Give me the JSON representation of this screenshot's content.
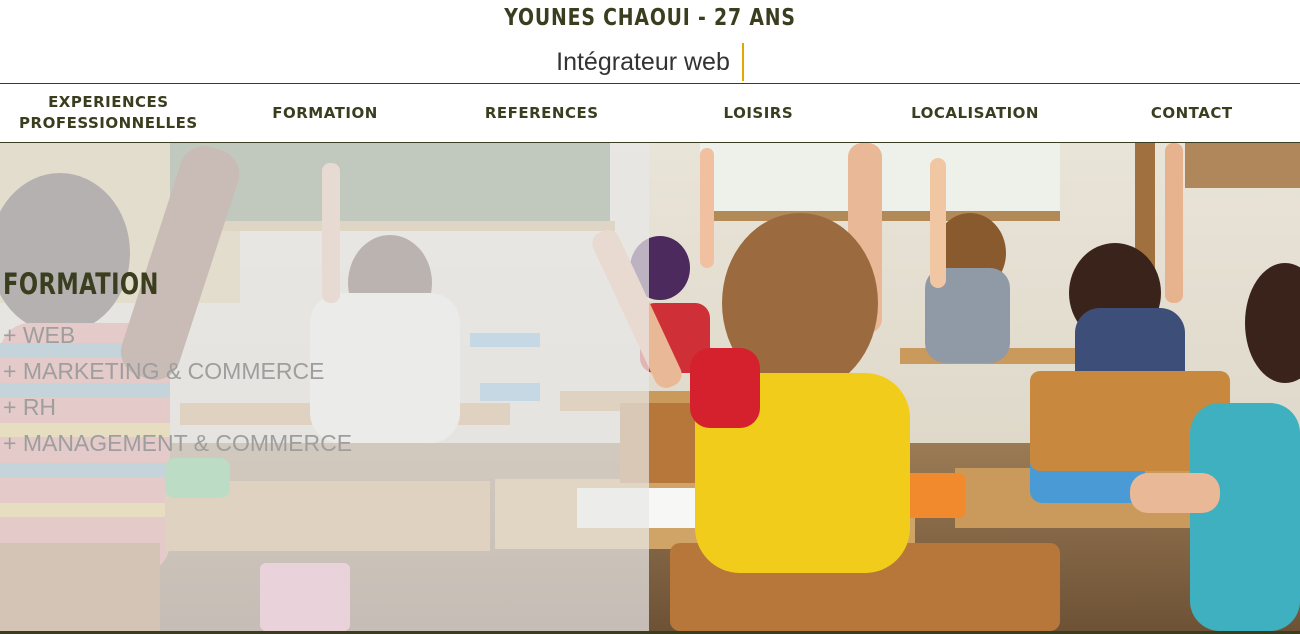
{
  "header": {
    "title": "YOUNES CHAOUI - 27 ANS",
    "subtitle": "Intégrateur web"
  },
  "nav": {
    "items": [
      {
        "label": "EXPERIENCES\nPROFESSIONNELLES"
      },
      {
        "label": "FORMATION"
      },
      {
        "label": "REFERENCES"
      },
      {
        "label": "LOISIRS"
      },
      {
        "label": "LOCALISATION"
      },
      {
        "label": "CONTACT"
      }
    ]
  },
  "section": {
    "title": "FORMATION",
    "items": [
      {
        "label": "+ WEB"
      },
      {
        "label": "+ MARKETING & COMMERCE"
      },
      {
        "label": "+ RH"
      },
      {
        "label": "+ MANAGEMENT & COMMERCE"
      }
    ]
  },
  "colors": {
    "brand": "#3b3d1f",
    "cursor_accent": "#e0a800",
    "overlay": "#e8e8e8",
    "list_text": "#9e9e9e"
  }
}
